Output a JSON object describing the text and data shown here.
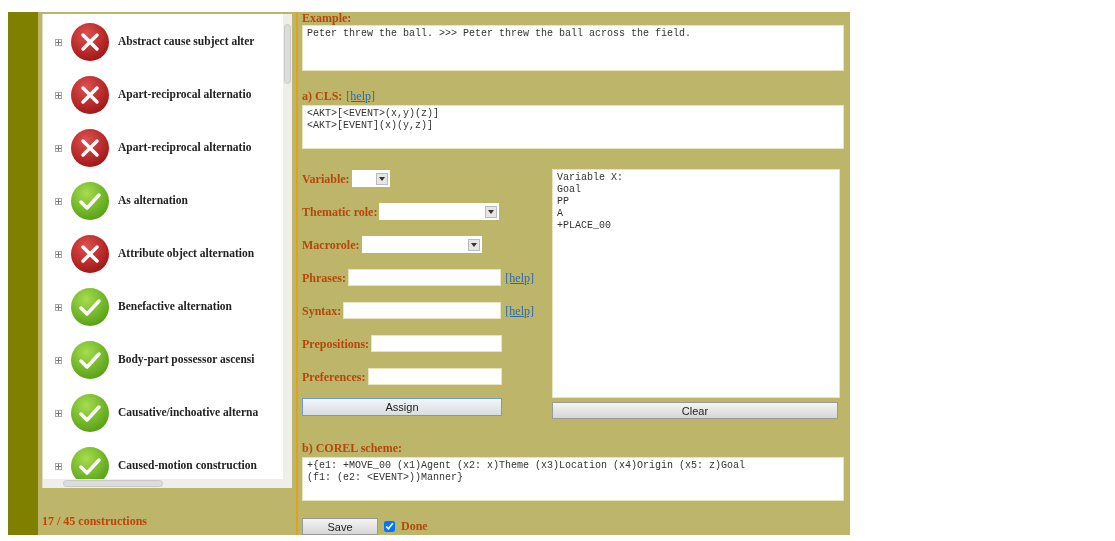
{
  "constructions": {
    "items": [
      {
        "label": "Abstract cause subject alter",
        "done": false,
        "expanded": false
      },
      {
        "label": "Apart-reciprocal alternatio",
        "done": false,
        "expanded": false
      },
      {
        "label": "Apart-reciprocal alternatio",
        "done": false,
        "expanded": false
      },
      {
        "label": "As alternation",
        "done": true,
        "expanded": false
      },
      {
        "label": "Attribute object alternation",
        "done": false,
        "expanded": false
      },
      {
        "label": "Benefactive alternation",
        "done": true,
        "expanded": false
      },
      {
        "label": "Body-part possessor ascensi",
        "done": true,
        "expanded": false
      },
      {
        "label": "Causative/inchoative alterna",
        "done": true,
        "expanded": false
      },
      {
        "label": "Caused-motion construction",
        "done": true,
        "expanded": false
      }
    ],
    "count": "17 / 45 constructions"
  },
  "example": {
    "label": "Example:",
    "value": "Peter threw the ball. >>> Peter threw the ball across the field."
  },
  "cls": {
    "label": "a) CLS:",
    "help": "[help]",
    "value": "<AKT>[<EVENT>(x,y)(z)]\n<AKT>[EVENT](x)(y,z)]"
  },
  "fields": [
    {
      "kind": "minidropdown",
      "label": "Variable:"
    },
    {
      "kind": "dropdown",
      "label": "Thematic role:"
    },
    {
      "kind": "dropdown",
      "label": "Macrorole:"
    },
    {
      "kind": "text",
      "label": "Phrases:",
      "help": "[help]"
    },
    {
      "kind": "text",
      "label": "Syntax:",
      "help": "[help]"
    },
    {
      "kind": "text",
      "label": "Prepositions:"
    },
    {
      "kind": "text",
      "label": "Preferences:"
    }
  ],
  "assign_button": "Assign",
  "variable_info": {
    "value": "Variable X:\nGoal\nPP\nA\n+PLACE_00"
  },
  "clear_button": "Clear",
  "corel": {
    "label": "b) COREL scheme:",
    "value": "+{e1: +MOVE_00 (x1)Agent (x2: x)Theme (x3)Location (x4)Origin (x5: z)Goal\n(f1: (e2: <EVENT>))Manner}"
  },
  "save_button": "Save",
  "done": {
    "label": "Done",
    "checked": true
  }
}
